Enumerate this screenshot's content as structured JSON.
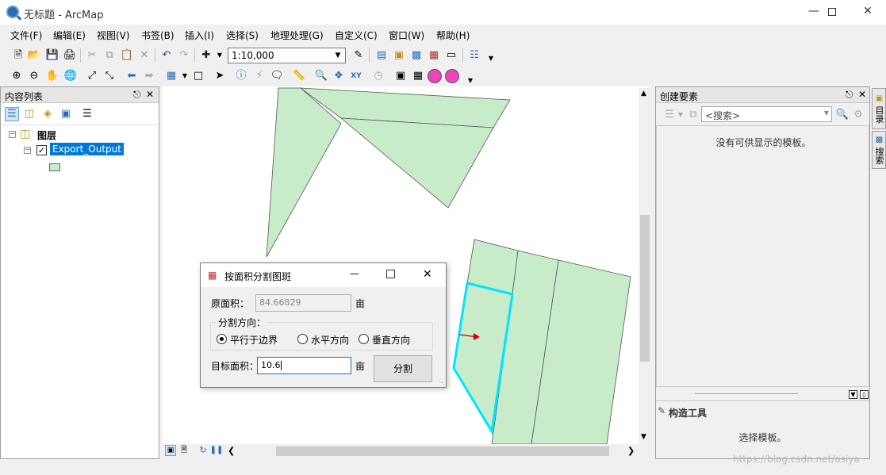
{
  "window": {
    "title": "无标题 - ArcMap"
  },
  "menu": [
    "文件(F)",
    "编辑(E)",
    "视图(V)",
    "书签(B)",
    "插入(I)",
    "选择(S)",
    "地理处理(G)",
    "自定义(C)",
    "窗口(W)",
    "帮助(H)"
  ],
  "toolbar": {
    "scale_value": "1:10,000"
  },
  "toc": {
    "title": "内容列表",
    "group_label": "图层",
    "layer_label": "Export_Output",
    "layer_symbol_color": "#c8ecca"
  },
  "create_features": {
    "title": "创建要素",
    "search_placeholder": "<搜索>",
    "empty_message": "没有可供显示的模板。",
    "construct_title": "构造工具",
    "construct_message": "选择模板。"
  },
  "side_tabs": [
    "目录",
    "搜索"
  ],
  "dialog": {
    "title": "按面积分割图斑",
    "original_area_label": "原面积：",
    "original_area_value": "84.66829",
    "area_unit": "亩",
    "direction_group_label": "分割方向：",
    "options": [
      "平行于边界",
      "水平方向",
      "垂直方向"
    ],
    "selected_option": "平行于边界",
    "target_area_label": "目标面积：",
    "target_area_value": "10.6",
    "split_button": "分割"
  },
  "colors": {
    "polygon_fill": "#c8ecca",
    "selection_outline": "#00e5ff",
    "accent": "#0078d7"
  },
  "watermark": "https://blog.csdn.net/asiya"
}
